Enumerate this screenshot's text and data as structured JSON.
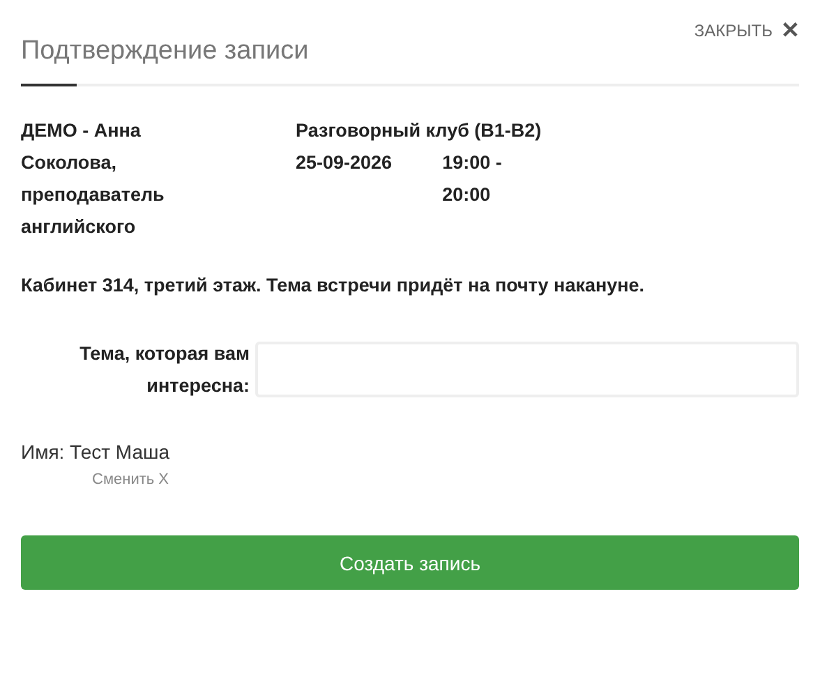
{
  "dialog": {
    "title": "Подтверждение записи",
    "close_label": "ЗАКРЫТЬ",
    "close_icon": "✕"
  },
  "booking": {
    "teacher": "ДЕМО - Анна Соколова, преподаватель английского",
    "event": "Разговорный клуб (B1-B2)",
    "date": "25-09-2026",
    "time": "19:00 - 20:00"
  },
  "note": "Кабинет 314, третий этаж. Тема встречи придёт на почту накануне.",
  "topic_field": {
    "label": "Тема, которая вам интересна:"
  },
  "name": "Имя: Тест Маша",
  "change_link": "Сменить X",
  "submit": "Создать запись"
}
